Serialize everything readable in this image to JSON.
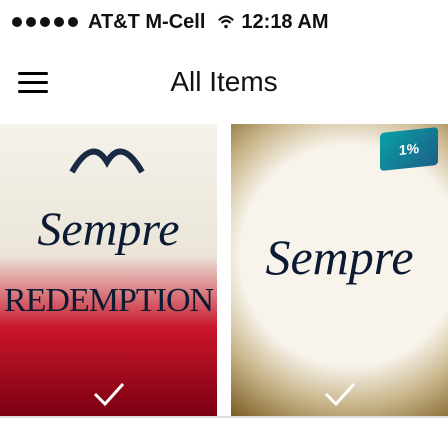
{
  "status_bar": {
    "carrier": "AT&T M-Cell",
    "time": "12:18 AM"
  },
  "nav": {
    "title": "All Items",
    "menu_icon": "hamburger-menu-icon"
  },
  "items": [
    {
      "cover_title": "Sempre",
      "cover_subtitle": "REDEMPTION"
    },
    {
      "cover_title": "Sempre",
      "badge_text": "1%"
    }
  ],
  "colors": {
    "text": "#111111",
    "cover1_red": "#c9152a",
    "cover2_gold": "#c8b58a",
    "badge_teal": "#0aa0a6"
  }
}
